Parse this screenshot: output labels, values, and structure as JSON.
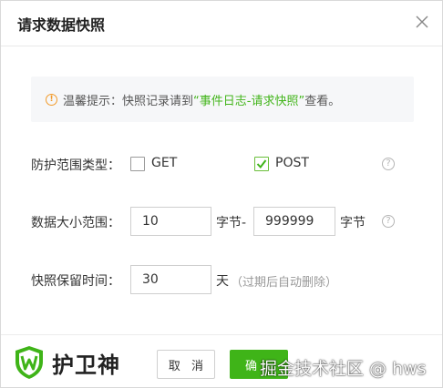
{
  "dialog": {
    "title": "请求数据快照"
  },
  "tip": {
    "icon": "warning-icon",
    "prefix": "温馨提示：快照记录请到",
    "link": "“事件日志-请求快照”",
    "suffix": "查看。",
    "link_color": "#43b51c"
  },
  "protect_type": {
    "label": "防护范围类型：",
    "options": [
      {
        "label": "GET",
        "checked": false
      },
      {
        "label": "POST",
        "checked": true
      }
    ]
  },
  "data_size": {
    "label": "数据大小范围：",
    "min_value": "10",
    "min_unit": "字节-",
    "max_value": "999999",
    "max_unit": "字节"
  },
  "retention": {
    "label": "快照保留时间：",
    "value": "30",
    "unit": "天",
    "note": "（过期后自动删除）"
  },
  "footer": {
    "logo_text": "护卫神",
    "cancel_label": "取 消",
    "ok_label": "确",
    "watermark": "掘金技术社区 @ hws"
  },
  "colors": {
    "accent_green": "#3fb418",
    "warning_orange": "#f29b2b"
  }
}
